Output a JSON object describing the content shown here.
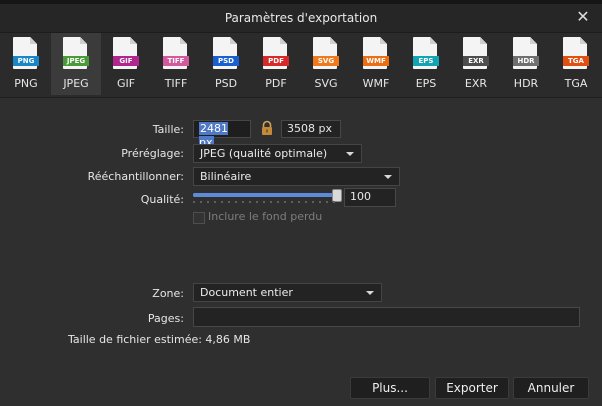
{
  "dialog": {
    "title": "Paramètres d'exportation"
  },
  "formats": [
    {
      "label": "PNG",
      "badge": "PNG",
      "color": "#1b86c6"
    },
    {
      "label": "JPEG",
      "badge": "JPEG",
      "color": "#4a9a3a"
    },
    {
      "label": "GIF",
      "badge": "GIF",
      "color": "#b0258e"
    },
    {
      "label": "TIFF",
      "badge": "TIFF",
      "color": "#d15a9f"
    },
    {
      "label": "PSD",
      "badge": "PSD",
      "color": "#1a5fd0"
    },
    {
      "label": "PDF",
      "badge": "PDF",
      "color": "#d62a2a"
    },
    {
      "label": "SVG",
      "badge": "SVG",
      "color": "#ee7a1d"
    },
    {
      "label": "WMF",
      "badge": "WMF",
      "color": "#ea6f14"
    },
    {
      "label": "EPS",
      "badge": "EPS",
      "color": "#14a3b2"
    },
    {
      "label": "EXR",
      "badge": "EXR",
      "color": "#4d4d4d"
    },
    {
      "label": "HDR",
      "badge": "HDR",
      "color": "#6f6f6f"
    },
    {
      "label": "TGA",
      "badge": "TGA",
      "color": "#e05013"
    }
  ],
  "selected_format": "JPEG",
  "size": {
    "label": "Taille:",
    "width": "2481 px",
    "height": "3508 px"
  },
  "preset": {
    "label": "Préréglage:",
    "value": "JPEG (qualité optimale)"
  },
  "resample": {
    "label": "Rééchantillonner:",
    "value": "Bilinéaire"
  },
  "quality": {
    "label": "Qualité:",
    "value": "100",
    "level": 100
  },
  "background_checkbox": {
    "label": "Inclure le fond perdu",
    "checked": false,
    "enabled": false
  },
  "zone": {
    "label": "Zone:",
    "value": "Document entier"
  },
  "pages": {
    "label": "Pages:",
    "value": ""
  },
  "filesize": {
    "label": "Taille de fichier estimée: 4,86 MB"
  },
  "buttons": {
    "more": "Plus...",
    "export": "Exporter",
    "cancel": "Annuler"
  }
}
